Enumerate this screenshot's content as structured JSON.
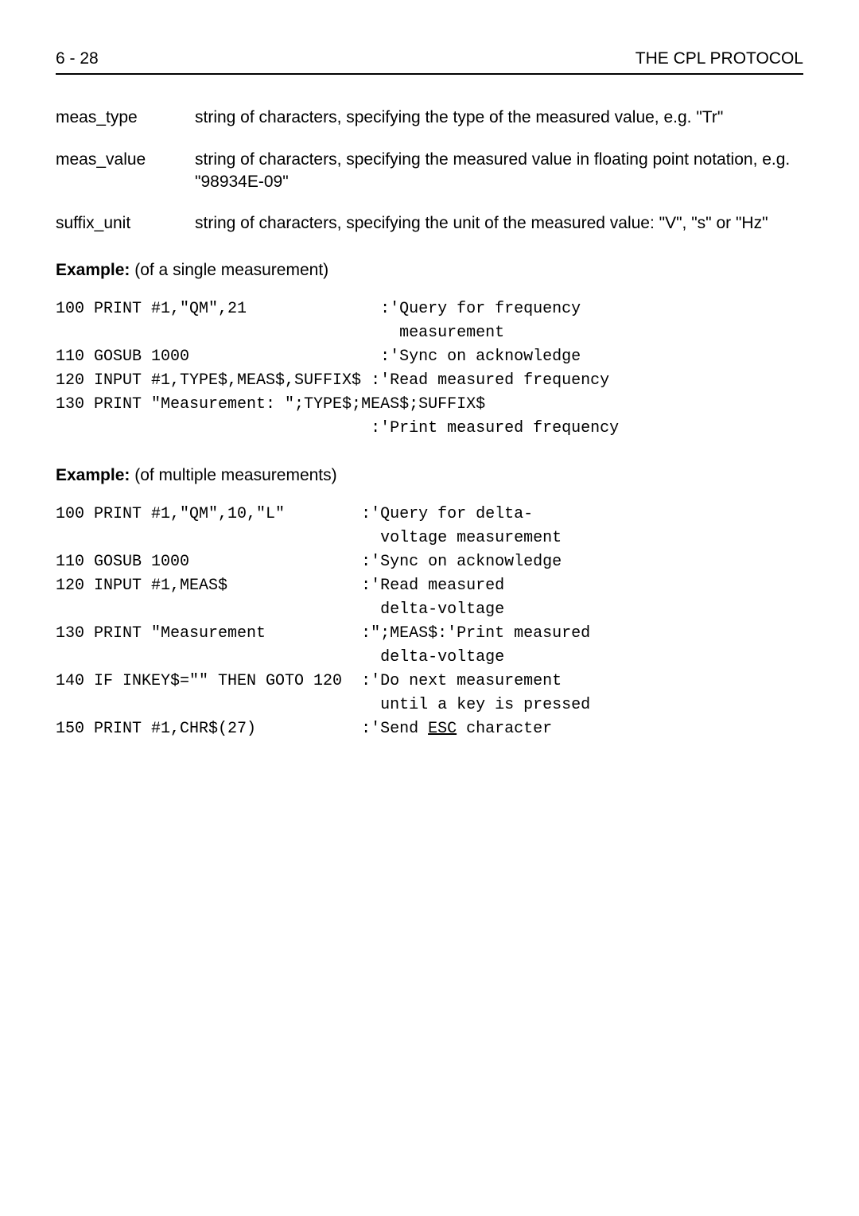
{
  "header": {
    "page": "6 - 28",
    "title": "THE CPL PROTOCOL"
  },
  "definitions": [
    {
      "term": "meas_type",
      "desc": "string of characters, specifying the type of the measured value, e.g. \"Tr\""
    },
    {
      "term": "meas_value",
      "desc": "string of characters, specifying the measured value in floating point notation, e.g. \"98934E-09\""
    },
    {
      "term": "suffix_unit",
      "desc": "string of characters, specifying the unit of the measured value: \"V\", \"s\" or \"Hz\""
    }
  ],
  "example1": {
    "label_bold": "Example:",
    "label_rest": " (of a single measurement)",
    "lines": [
      "100 PRINT #1,\"QM\",21              :'Query for frequency",
      "                                    measurement",
      "110 GOSUB 1000                    :'Sync on acknowledge",
      "120 INPUT #1,TYPE$,MEAS$,SUFFIX$ :'Read measured frequency",
      "130 PRINT \"Measurement: \";TYPE$;MEAS$;SUFFIX$",
      "                                 :'Print measured frequency"
    ]
  },
  "example2": {
    "label_bold": "Example:",
    "label_rest": " (of multiple measurements)",
    "lines": [
      "100 PRINT #1,\"QM\",10,\"L\"        :'Query for delta-",
      "                                  voltage measurement",
      "110 GOSUB 1000                  :'Sync on acknowledge",
      "120 INPUT #1,MEAS$              :'Read measured",
      "                                  delta-voltage",
      "130 PRINT \"Measurement          :\";MEAS$:'Print measured",
      "                                  delta-voltage",
      "140 IF INKEY$=\"\" THEN GOTO 120  :'Do next measurement",
      "                                  until a key is pressed"
    ],
    "last_line_prefix": "150 PRINT #1,CHR$(27)           :'Send ",
    "last_line_underlined": "ESC",
    "last_line_suffix": " character"
  }
}
